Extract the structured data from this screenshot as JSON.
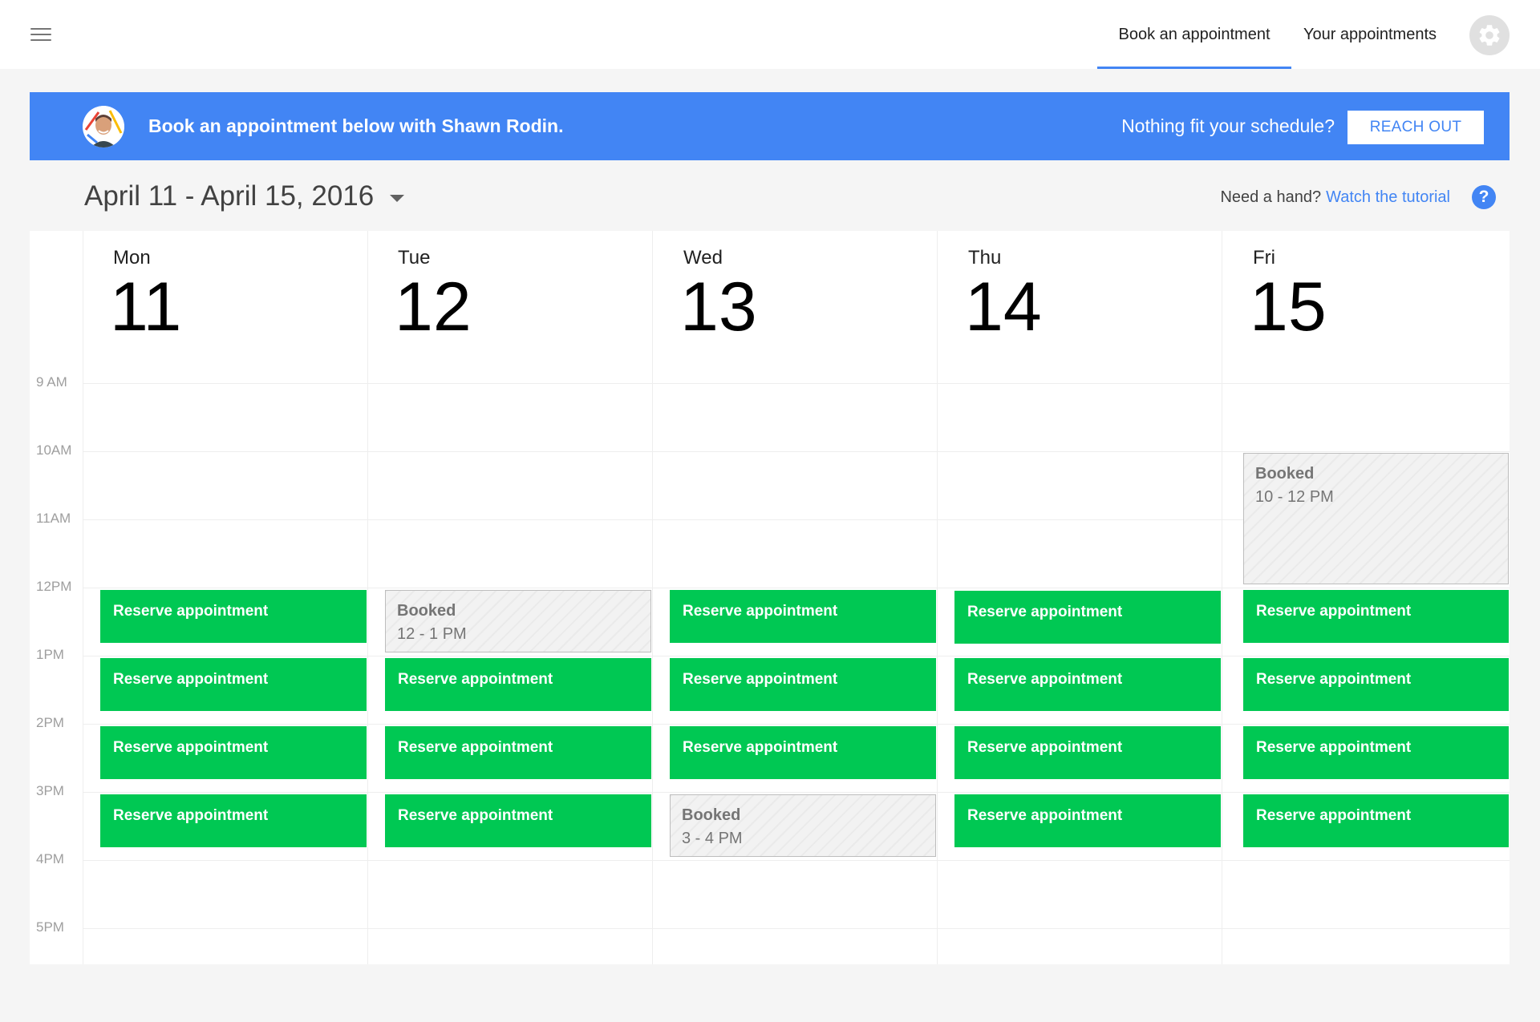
{
  "topbar": {
    "tabs": [
      {
        "label": "Book an appointment",
        "active": true
      },
      {
        "label": "Your appointments",
        "active": false
      }
    ],
    "menu_icon": "hamburger-menu-icon",
    "settings_icon": "gear-icon"
  },
  "banner": {
    "title": "Book an appointment below with Shawn Rodin.",
    "question": "Nothing fit your schedule?",
    "button": "REACH OUT"
  },
  "range": {
    "label": "April 11 - April 15, 2016",
    "help_prefix": "Need a hand?",
    "help_link": "Watch the tutorial",
    "help_icon": "?"
  },
  "calendar": {
    "times": [
      "9 AM",
      "10AM",
      "11AM",
      "12PM",
      "1PM",
      "2PM",
      "3PM",
      "4PM",
      "5PM"
    ],
    "days": [
      {
        "name": "Mon",
        "num": "11"
      },
      {
        "name": "Tue",
        "num": "12"
      },
      {
        "name": "Wed",
        "num": "13"
      },
      {
        "name": "Thu",
        "num": "14"
      },
      {
        "name": "Fri",
        "num": "15"
      }
    ],
    "reserve_label": "Reserve appointment",
    "booked_label": "Booked",
    "booked_times": {
      "tue_12": "12 - 1 PM",
      "wed_3": "3 - 4 PM",
      "fri_10": "10 - 12 PM"
    }
  },
  "colors": {
    "primary": "#4285f4",
    "reserve": "#00c853",
    "booked_bg": "#f2f2f2"
  }
}
